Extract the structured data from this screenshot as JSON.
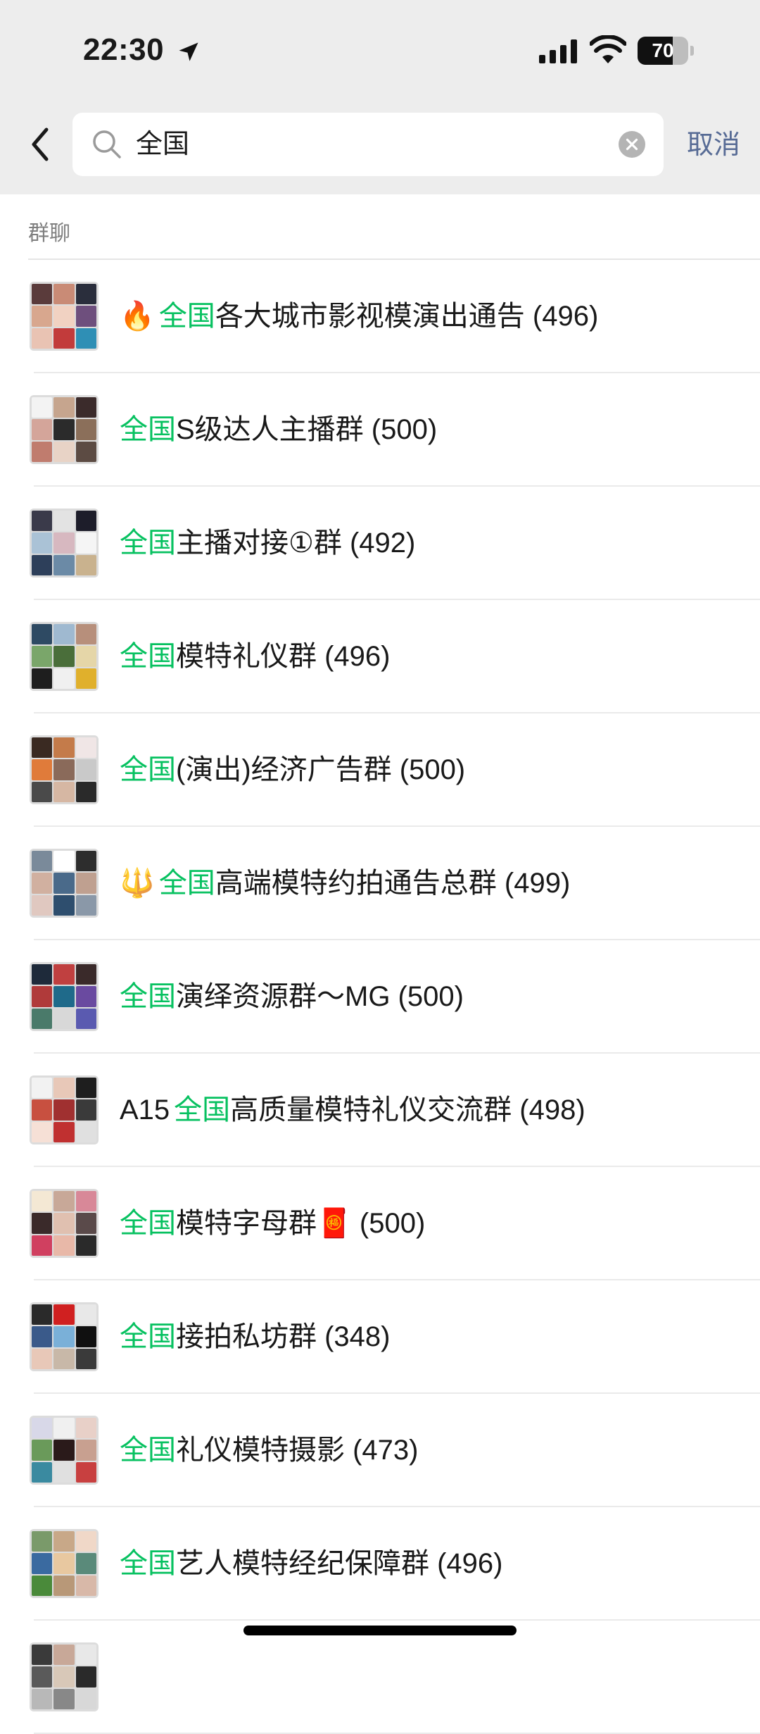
{
  "status_bar": {
    "time": "22:30",
    "battery": "70",
    "battery_level": 0.7
  },
  "search": {
    "query": "全国",
    "cancel_label": "取消"
  },
  "section": {
    "title": "群聊"
  },
  "colors": {
    "highlight": "#07c160",
    "cancel": "#576b95",
    "header_bg": "#ededed"
  },
  "groups": [
    {
      "prefix": "🔥",
      "keyword": "全国",
      "suffix": "各大城市影视模演出通告 (496)"
    },
    {
      "prefix": "",
      "keyword": "全国",
      "suffix": "S级达人主播群 (500)"
    },
    {
      "prefix": "",
      "keyword": "全国",
      "suffix": "主播对接①群 (492)"
    },
    {
      "prefix": "",
      "keyword": "全国",
      "suffix": "模特礼仪群 (496)"
    },
    {
      "prefix": "",
      "keyword": "全国",
      "suffix": "(演出)经济广告群 (500)"
    },
    {
      "prefix": "🔱",
      "keyword": "全国",
      "suffix": "高端模特约拍通告总群 (499)"
    },
    {
      "prefix": "",
      "keyword": "全国",
      "suffix": "演绎资源群～MG (500)"
    },
    {
      "prefix": "A15",
      "keyword": "全国",
      "suffix": "高质量模特礼仪交流群 (498)"
    },
    {
      "prefix": "",
      "keyword": "全国",
      "suffix": "模特字母群🧧 (500)"
    },
    {
      "prefix": "",
      "keyword": "全国",
      "suffix": "接拍私坊群 (348)"
    },
    {
      "prefix": "",
      "keyword": "全国",
      "suffix": "礼仪模特摄影 (473)"
    },
    {
      "prefix": "",
      "keyword": "全国",
      "suffix": "艺人模特经纪保障群 (496)"
    },
    {
      "prefix": "",
      "keyword": "",
      "suffix": ""
    }
  ]
}
